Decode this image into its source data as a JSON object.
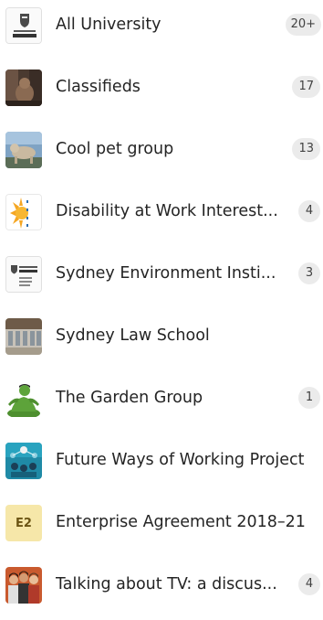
{
  "teams": [
    {
      "name": "All University",
      "count": "20+"
    },
    {
      "name": "Classifieds",
      "count": "17"
    },
    {
      "name": "Cool pet group",
      "count": "13"
    },
    {
      "name": "Disability at Work Interest...",
      "count": "4"
    },
    {
      "name": "Sydney Environment Insti...",
      "count": "3"
    },
    {
      "name": "Sydney Law School",
      "count": ""
    },
    {
      "name": "The Garden Group",
      "count": "1"
    },
    {
      "name": "Future Ways of Working Project",
      "count": ""
    },
    {
      "name": "Enterprise Agreement 2018–21",
      "count": "",
      "initials": "E2"
    },
    {
      "name": "Talking about TV: a discus...",
      "count": "4"
    }
  ],
  "colors": {
    "badge_bg": "#ebebeb",
    "badge_text": "#424242",
    "label_text": "#242424",
    "e2_avatar_bg": "#f6e7a9"
  },
  "icons": {
    "all_university": "university-of-sydney-logo",
    "classifieds": "cat-photo",
    "cool_pet_group": "dog-photo",
    "disability": "sun-logo",
    "environment": "university-of-sydney-logo",
    "law_school": "building-photo",
    "garden_group": "hulk-figure",
    "future_ways": "network-illustration",
    "talking_tv": "people-photo"
  }
}
